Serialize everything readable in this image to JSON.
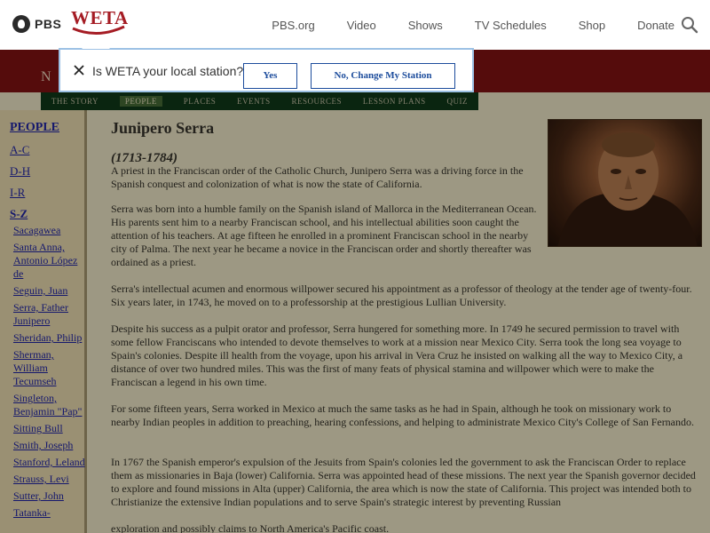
{
  "topbar": {
    "pbs_label": "PBS",
    "station_label": "WETA",
    "nav": [
      "PBS.org",
      "Video",
      "Shows",
      "TV Schedules",
      "Shop",
      "Donate"
    ],
    "search_icon": "search-icon"
  },
  "banner": {
    "text": "N   F        E   T",
    "sections": [
      "THE STORY",
      "PEOPLE",
      "PLACES",
      "EVENTS",
      "RESOURCES",
      "LESSON PLANS",
      "QUIZ"
    ],
    "active_section": "PEOPLE"
  },
  "sidebar": {
    "header": "PEOPLE",
    "letters_top": [
      "A-C",
      "D-H",
      "I-R"
    ],
    "current_letter": "S-Z",
    "people": [
      "Sacagawea",
      "Santa Anna, Antonio López de",
      "Seguin, Juan",
      "Serra, Father Junipero",
      "Sheridan, Philip",
      "Sherman, William Tecumseh",
      "Singleton, Benjamin \"Pap\"",
      "Sitting Bull",
      "Smith, Joseph",
      "Stanford, Leland",
      "Strauss, Levi",
      "Sutter, John",
      "Tatanka-"
    ]
  },
  "article": {
    "title": "Junipero Serra",
    "dates": "(1713-1784)",
    "paragraphs": [
      "A priest in the Franciscan order of the Catholic Church, Junipero Serra was a driving force in the Spanish conquest and colonization of what is now the state of California.",
      "Serra was born into a humble family on the Spanish island of Mallorca in the Mediterranean Ocean. His parents sent him to a nearby Franciscan school, and his intellectual abilities soon caught the attention of his teachers. At age fifteen he enrolled in a prominent Franciscan school in the nearby city of Palma. The next year he became a novice in the Franciscan order and shortly thereafter was ordained as a priest.",
      "Serra's intellectual acumen and enormous willpower secured his appointment as a professor of theology at the tender age of twenty-four. Six years later, in 1743, he moved on to a professorship at the prestigious Lullian University.",
      "Despite his success as a pulpit orator and professor, Serra hungered for something more. In 1749 he secured permission to travel with some fellow Franciscans who intended to devote themselves to work at a mission near Mexico City. Serra took the long sea voyage to Spain's colonies. Despite ill health from the voyage, upon his arrival in Vera Cruz he insisted on walking all the way to Mexico City, a distance of over two hundred miles. This was the first of many feats of physical stamina and willpower which were to make the Franciscan a legend in his own time.",
      "For some fifteen years, Serra worked in Mexico at much the same tasks as he had in Spain, although he took on missionary work to nearby Indian peoples in addition to preaching, hearing confessions, and helping to administrate Mexico City's College of San Fernando.",
      "In 1767 the Spanish emperor's expulsion of the Jesuits from Spain's colonies led the government to ask the Franciscan Order to replace them as missionaries in Baja (lower) California. Serra was appointed head of these missions. The next year the Spanish governor decided to explore and found missions in Alta (upper) California, the area which is now the state of California. This project was intended both to Christianize the extensive Indian populations and to serve Spain's strategic interest by preventing Russian",
      "exploration and possibly claims to North America's Pacific coast."
    ]
  },
  "popup": {
    "question": "Is WETA your local station?",
    "yes_label": "Yes",
    "change_label": "No, Change My Station"
  },
  "colors": {
    "banner": "#6e1010",
    "section_nav": "#0e3015",
    "sidebar": "#c6b994",
    "link": "#1b1f8c",
    "popup_button": "#1c4c9c"
  }
}
